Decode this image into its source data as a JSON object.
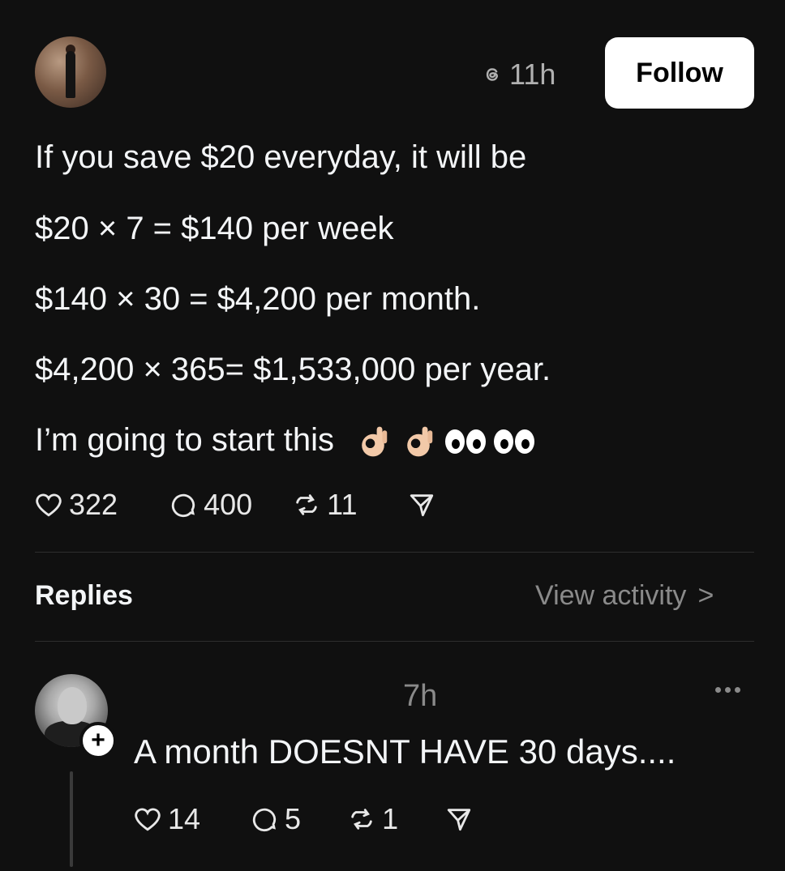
{
  "post": {
    "time": "11h",
    "follow_label": "Follow",
    "lines": [
      "If you save $20 everyday, it will be",
      "$20 × 7 = $140 per week",
      "$140 × 30 = $4,200 per month.",
      "$4,200 × 365= $1,533,000 per year.",
      "I’m going to start this"
    ],
    "emojis": [
      "ok-hand",
      "ok-hand",
      "eyes",
      "eyes"
    ],
    "stats": {
      "likes": "322",
      "comments": "400",
      "reposts": "11"
    }
  },
  "replies_section": {
    "label": "Replies",
    "view_activity": "View activity",
    "chevron": ">"
  },
  "reply": {
    "time": "7h",
    "text": "A month DOESNT HAVE 30 days....",
    "plus": "+",
    "stats": {
      "likes": "14",
      "comments": "5",
      "reposts": "1"
    }
  },
  "colors": {
    "background": "#101010",
    "text": "#f3f5f7",
    "muted": "#8a8a8a",
    "button": "#ffffff"
  },
  "icons": [
    "threads-icon",
    "heart-icon",
    "comment-icon",
    "repost-icon",
    "share-icon",
    "more-icon"
  ]
}
